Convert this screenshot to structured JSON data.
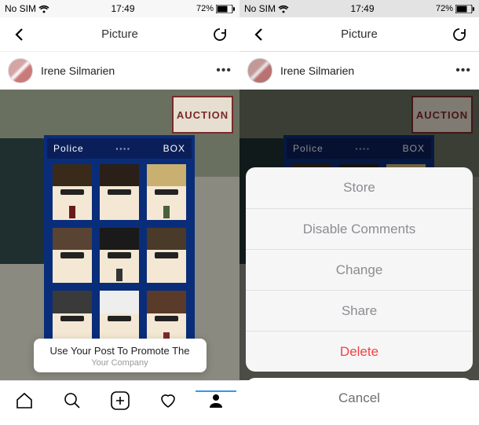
{
  "status": {
    "carrier": "No SIM",
    "time": "17:49",
    "battery_pct": "72%"
  },
  "nav": {
    "title": "Picture"
  },
  "user": {
    "name": "Irene Silmarien"
  },
  "post": {
    "auction_text": "AUCTION",
    "police_label": "Police",
    "box_label": "BOX",
    "promote_title": "Use Your Post To Promote The",
    "promote_sub": "Your Company"
  },
  "action_sheet": {
    "items": [
      {
        "label": "Store"
      },
      {
        "label": "Disable Comments"
      },
      {
        "label": "Change"
      },
      {
        "label": "Share"
      },
      {
        "label": "Delete",
        "destructive": true
      }
    ],
    "cancel": "Cancel"
  }
}
